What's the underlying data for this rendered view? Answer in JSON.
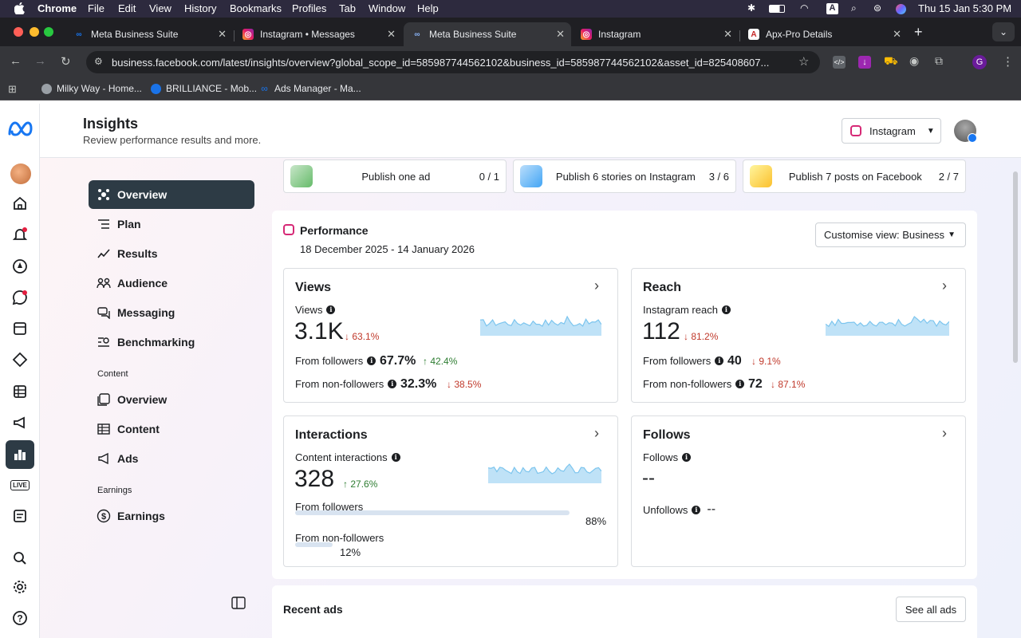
{
  "menubar": {
    "app": "Chrome",
    "items": [
      "File",
      "Edit",
      "View",
      "History",
      "Bookmarks",
      "Profiles",
      "Tab",
      "Window",
      "Help"
    ],
    "clock": "Thu 15 Jan  5:30 PM"
  },
  "browser": {
    "tabs": [
      {
        "title": "Meta Business Suite",
        "icon": "meta-icon"
      },
      {
        "title": "Instagram • Messages",
        "icon": "instagram-icon"
      },
      {
        "title": "Meta Business Suite",
        "icon": "meta-icon"
      },
      {
        "title": "Instagram",
        "icon": "instagram-icon"
      },
      {
        "title": "Apx-Pro Details",
        "icon": "apx-icon"
      }
    ],
    "url": "business.facebook.com/latest/insights/overview?global_scope_id=585987744562102&business_id=585987744562102&asset_id=825408607...",
    "profile_initial": "G",
    "bookmarks": [
      "Milky Way - Home...",
      "BRILLIANCE - Mob...",
      "Ads Manager - Ma..."
    ]
  },
  "header": {
    "title": "Insights",
    "subtitle": "Review performance results and more.",
    "account_selector": "Instagram"
  },
  "nav": {
    "items": [
      "Overview",
      "Plan",
      "Results",
      "Audience",
      "Messaging",
      "Benchmarking"
    ],
    "content_section": "Content",
    "content_items": [
      "Overview",
      "Content",
      "Ads"
    ],
    "earnings_section": "Earnings",
    "earnings_items": [
      "Earnings"
    ]
  },
  "progress_tiles": [
    {
      "label": "Publish one ad",
      "value": "0 / 1",
      "progress": 0
    },
    {
      "label": "Publish 6 stories on Instagram",
      "value": "3 / 6",
      "progress": 0.5
    },
    {
      "label": "Publish 7 posts on Facebook",
      "value": "2 / 7",
      "progress": 0.2857
    }
  ],
  "performance": {
    "title": "Performance",
    "date_range": "18 December 2025 - 14 January 2026",
    "customise": "Customise view: Business"
  },
  "views": {
    "title": "Views",
    "label": "Views",
    "value": "3.1K",
    "change": "63.1%",
    "followers_label": "From followers",
    "followers_value": "67.7%",
    "followers_change": "42.4%",
    "nonfollowers_label": "From non-followers",
    "nonfollowers_value": "32.3%",
    "nonfollowers_change": "38.5%"
  },
  "reach": {
    "title": "Reach",
    "label": "Instagram reach",
    "value": "112",
    "change": "81.2%",
    "followers_label": "From followers",
    "followers_value": "40",
    "followers_change": "9.1%",
    "nonfollowers_label": "From non-followers",
    "nonfollowers_value": "72",
    "nonfollowers_change": "87.1%"
  },
  "interactions": {
    "title": "Interactions",
    "label": "Content interactions",
    "value": "328",
    "change": "27.6%",
    "followers_label": "From followers",
    "followers_pct": "88%",
    "followers_share": 0.88,
    "nonfollowers_label": "From non-followers",
    "nonfollowers_pct": "12%",
    "nonfollowers_share": 0.12
  },
  "follows": {
    "title": "Follows",
    "label": "Follows",
    "value": "--",
    "unfollows_label": "Unfollows",
    "unfollows_value": "--"
  },
  "recent_ads": {
    "title": "Recent ads",
    "see_all": "See all ads"
  }
}
